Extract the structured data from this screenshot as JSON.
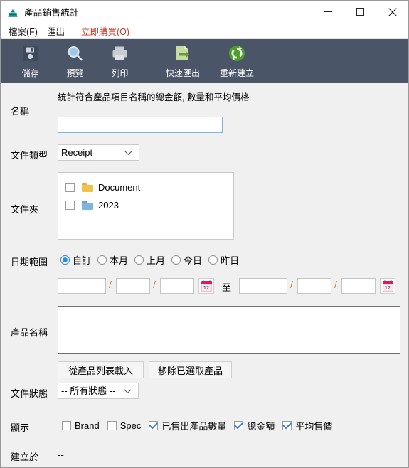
{
  "window": {
    "title": "產品銷售統計",
    "icon": "app-printer-icon",
    "minimize": "−",
    "maximize": "□",
    "close": "✕"
  },
  "menubar": {
    "items": [
      {
        "label": "檔案(F)",
        "name": "menu-file",
        "color": "#101010"
      },
      {
        "label": "匯出",
        "name": "menu-export",
        "color": "#101010"
      },
      {
        "label": "立即購買(O)",
        "name": "menu-buy-now",
        "color": "#c0392b"
      }
    ]
  },
  "toolbar": {
    "background": "#4a5568",
    "items": [
      {
        "label": "儲存",
        "icon": "save-floppy-icon"
      },
      {
        "label": "預覽",
        "icon": "preview-magnifier-icon"
      },
      {
        "label": "列印",
        "icon": "print-printer-icon"
      },
      {
        "label": "快速匯出",
        "icon": "quick-export-icon"
      },
      {
        "label": "重新建立",
        "icon": "rebuild-refresh-icon"
      }
    ]
  },
  "form": {
    "hint": "統計符合產品項目名稱的總金額, 數量和平均價格",
    "name": {
      "label": "名稱",
      "value": "",
      "placeholder": ""
    },
    "doc_type": {
      "label": "文件類型",
      "selected": "Receipt",
      "options": [
        "Receipt"
      ]
    },
    "folders": {
      "label": "文件夾",
      "items": [
        {
          "label": "Document",
          "checked": false,
          "color": "#f2c14a"
        },
        {
          "label": "2023",
          "checked": false,
          "color": "#7eb4dd"
        }
      ]
    },
    "date_range": {
      "label": "日期範圍",
      "options": [
        {
          "label": "自訂",
          "selected": true
        },
        {
          "label": "本月",
          "selected": false
        },
        {
          "label": "上月",
          "selected": false
        },
        {
          "label": "今日",
          "selected": false
        },
        {
          "label": "昨日",
          "selected": false
        }
      ],
      "separator": "/",
      "between_label": "至",
      "from": {
        "y": "",
        "m": "",
        "d": ""
      },
      "to": {
        "y": "",
        "m": "",
        "d": ""
      },
      "calendar_icon_day": "12"
    },
    "product_name": {
      "label": "產品名稱",
      "value": "",
      "buttons": [
        {
          "label": "從產品列表載入",
          "name": "load-from-product-list-button"
        },
        {
          "label": "移除已選取產品",
          "name": "remove-selected-product-button"
        }
      ]
    },
    "doc_status": {
      "label": "文件狀態",
      "selected": "-- 所有狀態 --",
      "options": [
        "-- 所有狀態 --"
      ]
    },
    "display": {
      "label": "顯示",
      "options": [
        {
          "label": "Brand",
          "checked": false
        },
        {
          "label": "Spec",
          "checked": false
        },
        {
          "label": "已售出產品數量",
          "checked": true
        },
        {
          "label": "總金額",
          "checked": true
        },
        {
          "label": "平均售價",
          "checked": true
        }
      ]
    },
    "created_at": {
      "label": "建立於",
      "value": "--"
    }
  }
}
